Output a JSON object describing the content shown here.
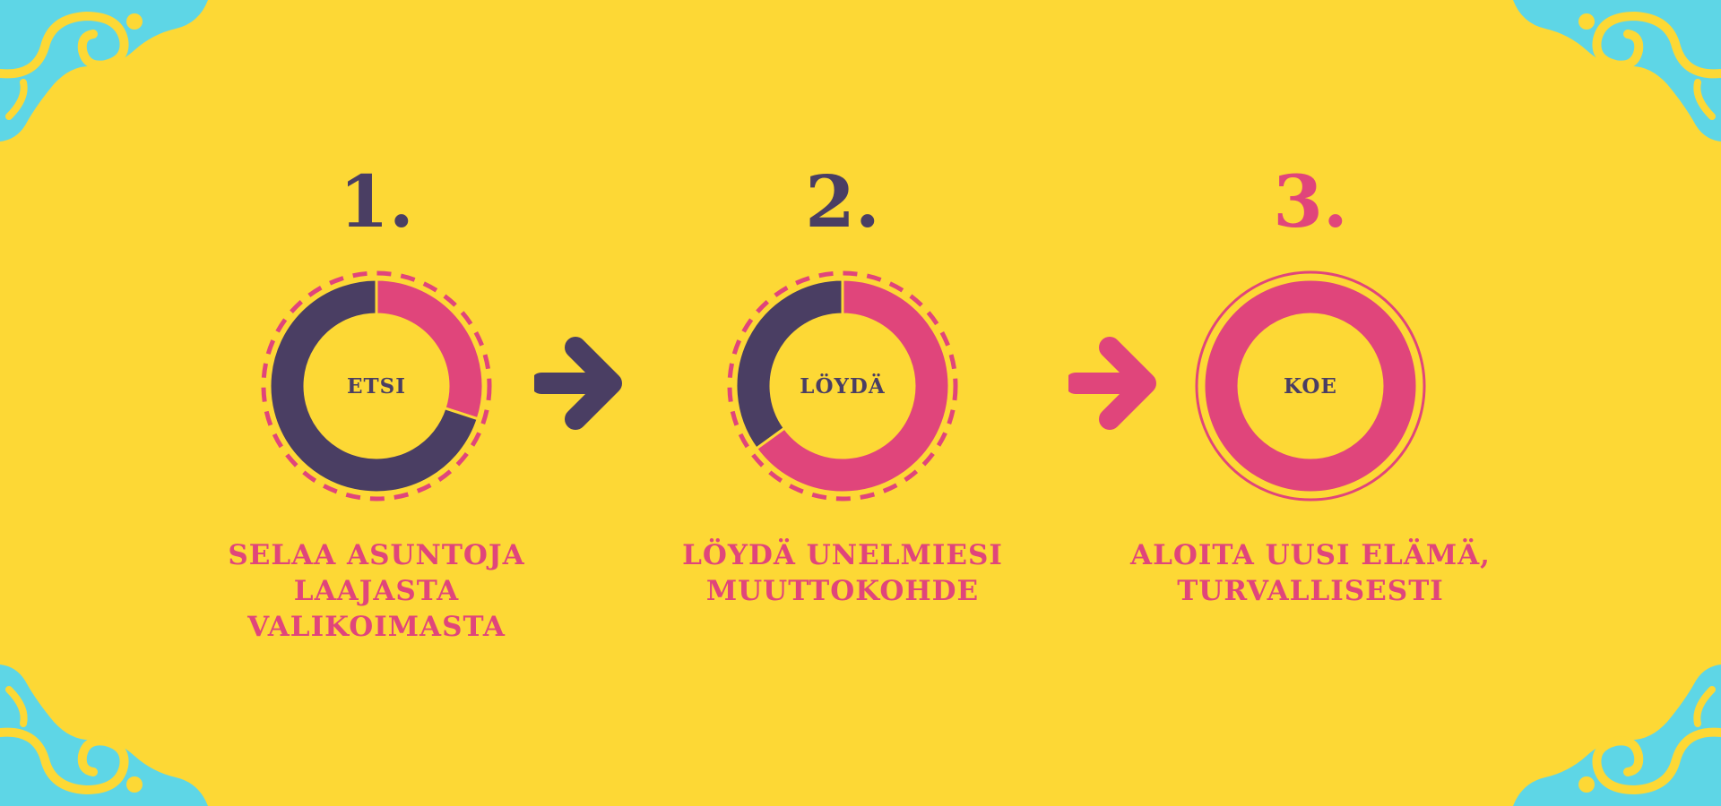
{
  "colors": {
    "background": "#FDD835",
    "pink": "#E0457B",
    "navy": "#4A3E63",
    "cyan": "#5ED6E6"
  },
  "ornament": "cyan-swirl-corner",
  "chart_data": [
    {
      "type": "pie",
      "step_number": "1.",
      "center_label": "ETSI",
      "segments": [
        {
          "color": "#E0457B",
          "fraction": 0.3
        },
        {
          "color": "#4A3E63",
          "fraction": 0.7
        }
      ],
      "outer_border": "dashed",
      "caption": "SELAA ASUNTOJA\nLAAJASTA\nVALIKOIMASTA"
    },
    {
      "type": "pie",
      "step_number": "2.",
      "center_label": "LÖYDÄ",
      "segments": [
        {
          "color": "#E0457B",
          "fraction": 0.65
        },
        {
          "color": "#4A3E63",
          "fraction": 0.35
        }
      ],
      "outer_border": "dashed",
      "caption": "LÖYDÄ UNELMIESI\nMUUTTOKOHDE"
    },
    {
      "type": "pie",
      "step_number": "3.",
      "center_label": "KOE",
      "segments": [
        {
          "color": "#E0457B",
          "fraction": 1.0
        }
      ],
      "outer_border": "solid",
      "caption": "ALOITA UUSI ELÄMÄ,\nTURVALLISESTI"
    }
  ],
  "arrows": [
    {
      "icon": "arrow-right-icon",
      "color": "#4A3E63"
    },
    {
      "icon": "arrow-right-icon",
      "color": "#E0457B"
    }
  ]
}
